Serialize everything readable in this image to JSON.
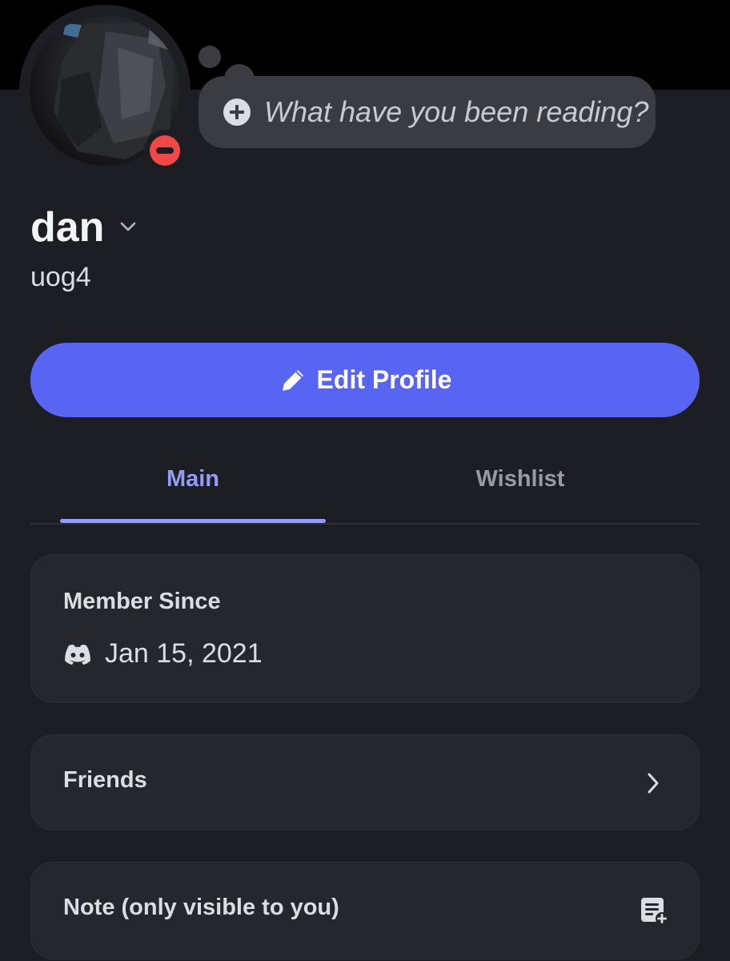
{
  "status": {
    "placeholder": "What have you been reading?",
    "add_icon": "plus-circle-icon"
  },
  "profile": {
    "display_name": "dan",
    "username": "uog4",
    "presence": "do-not-disturb",
    "presence_color": "#f04747"
  },
  "actions": {
    "edit_profile_label": "Edit Profile",
    "edit_icon": "pencil-icon",
    "accent_color": "#5865f2"
  },
  "tabs": [
    {
      "label": "Main",
      "active": true
    },
    {
      "label": "Wishlist",
      "active": false
    }
  ],
  "member_since": {
    "title": "Member Since",
    "date": "Jan 15, 2021",
    "icon": "discord-icon"
  },
  "friends": {
    "title": "Friends",
    "icon": "chevron-right-icon"
  },
  "note": {
    "title": "Note (only visible to you)",
    "icon": "add-note-icon"
  }
}
